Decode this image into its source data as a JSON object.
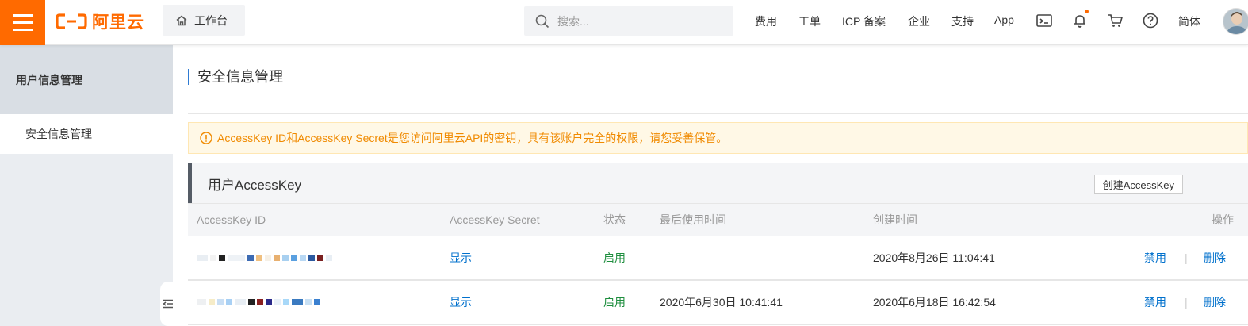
{
  "header": {
    "brand": "阿里云",
    "workbench_label": "工作台",
    "search_placeholder": "搜索...",
    "nav": [
      "费用",
      "工单",
      "ICP 备案",
      "企业",
      "支持",
      "App"
    ],
    "lang_label": "简体",
    "icons": [
      "menu-icon",
      "home-icon",
      "search-icon",
      "terminal-icon",
      "bell-icon",
      "cart-icon",
      "help-icon"
    ],
    "accent_color": "#ff6a00"
  },
  "sidebar": {
    "title": "用户信息管理",
    "items": [
      {
        "label": "安全信息管理"
      }
    ]
  },
  "main": {
    "page_title": "安全信息管理",
    "notice": "AccessKey ID和AccessKey Secret是您访问阿里云API的密钥，具有该账户完全的权限，请您妥善保管。",
    "panel_title": "用户AccessKey",
    "create_button": "创建AccessKey",
    "table": {
      "columns": [
        "AccessKey ID",
        "AccessKey Secret",
        "状态",
        "最后使用时间",
        "创建时间",
        "操作"
      ],
      "rows": [
        {
          "secret": "显示",
          "status": "启用",
          "last_used": "",
          "created": "2020年8月26日 11:04:41",
          "disable": "禁用",
          "delete": "删除"
        },
        {
          "secret": "显示",
          "status": "启用",
          "last_used": "2020年6月30日 10:41:41",
          "created": "2020年6月18日 16:42:54",
          "disable": "禁用",
          "delete": "删除"
        }
      ]
    }
  }
}
